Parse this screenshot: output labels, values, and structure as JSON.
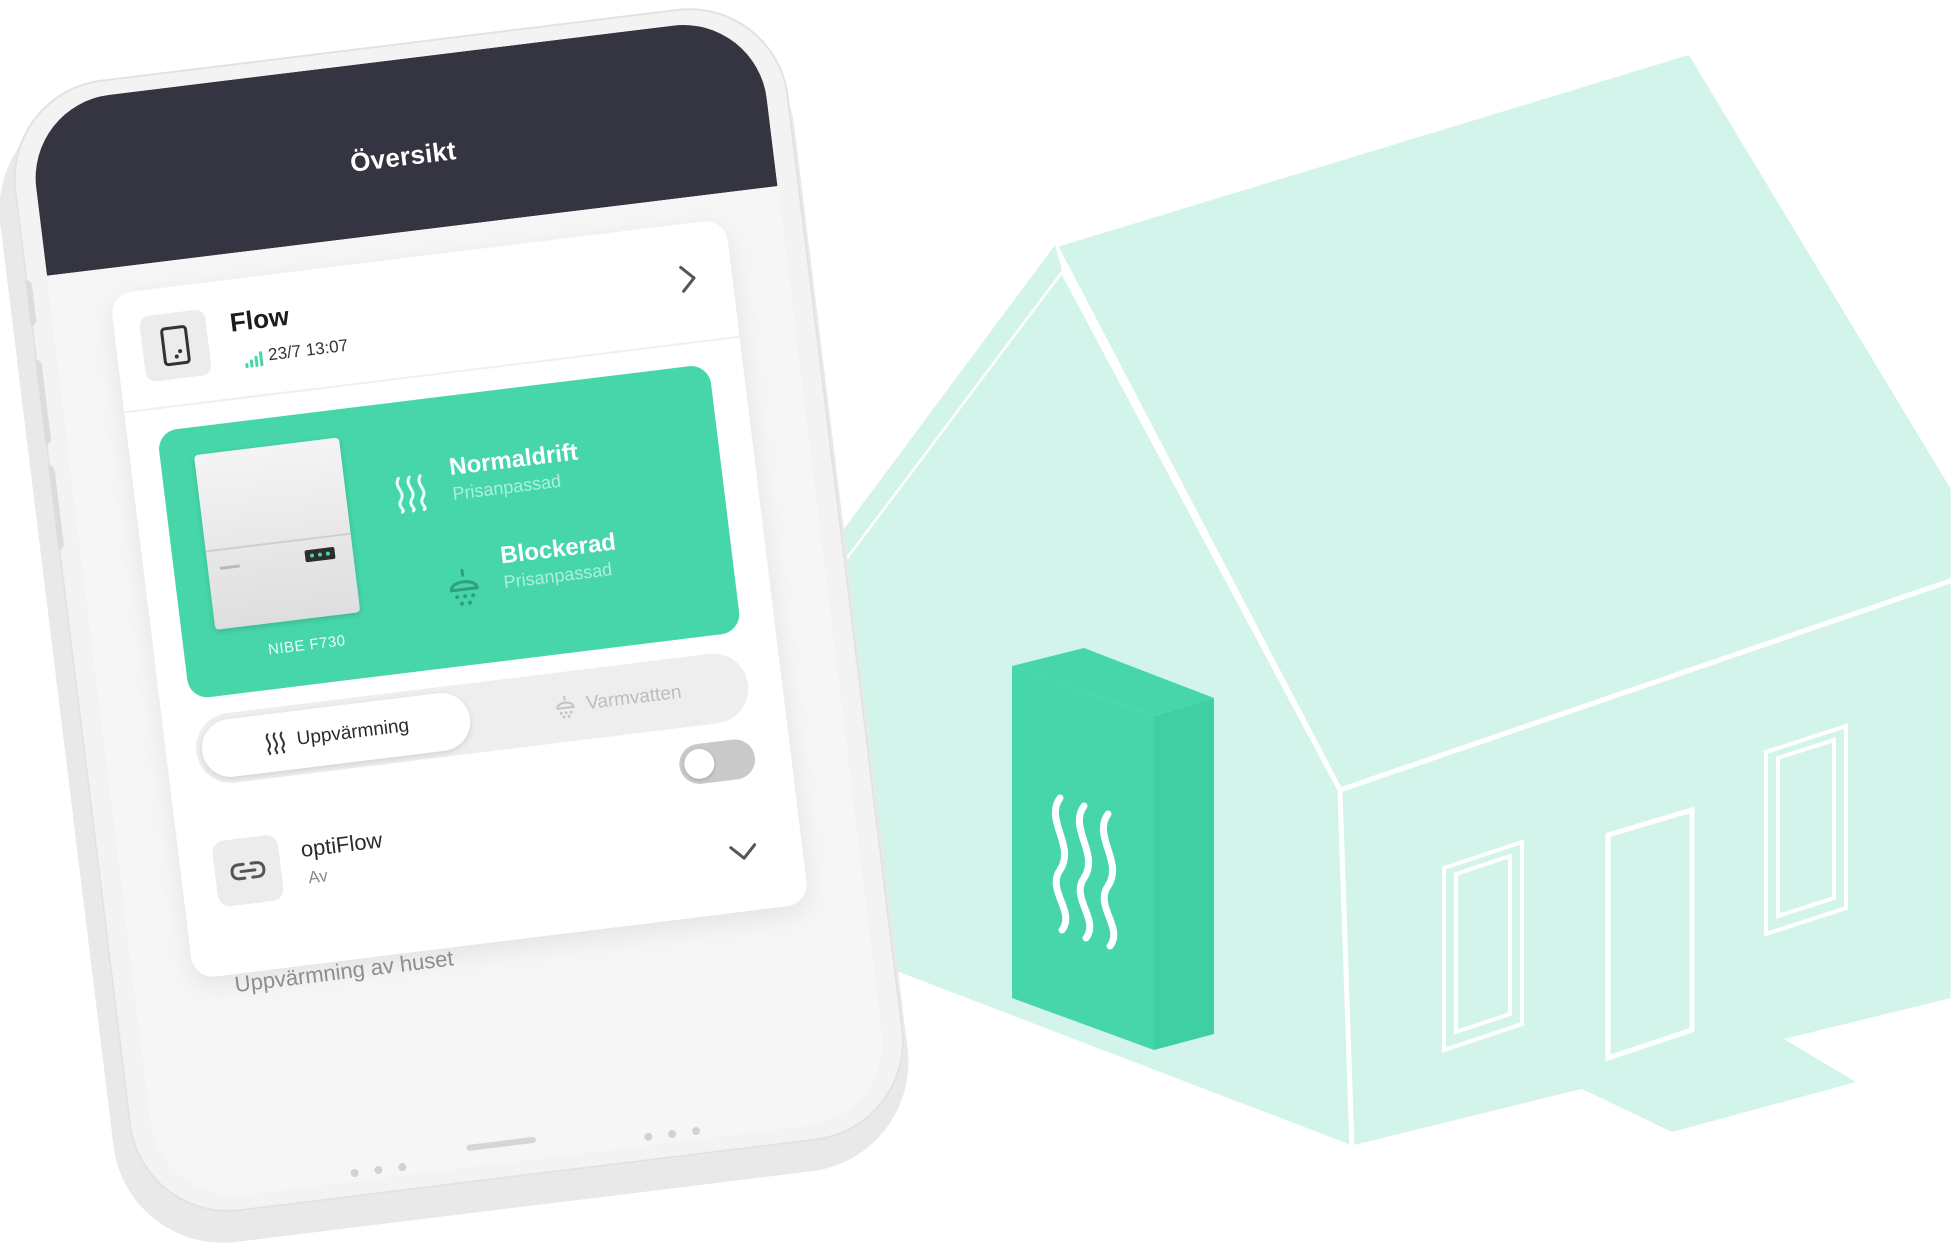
{
  "colors": {
    "accent": "#46d6aa",
    "header_bg": "#343540",
    "house_fill": "#d2f4ea",
    "house_stroke": "#ffffff"
  },
  "header": {
    "title": "Översikt"
  },
  "device": {
    "name": "Flow",
    "timestamp": "23/7 13:07",
    "icon": "phone-device-icon",
    "signal_icon": "signal-bars-icon"
  },
  "status": {
    "pump_model": "NIBE F730",
    "heating": {
      "title": "Normaldrift",
      "subtitle": "Prisanpassad",
      "icon": "heat-waves-icon"
    },
    "hot_water": {
      "title": "Blockerad",
      "subtitle": "Prisanpassad",
      "icon": "shower-icon"
    }
  },
  "tabs": [
    {
      "label": "Uppvärmning",
      "icon": "heat-waves-icon",
      "active": true
    },
    {
      "label": "Varmvatten",
      "icon": "shower-icon",
      "active": false
    }
  ],
  "optiflow": {
    "title": "optiFlow",
    "status": "Av",
    "icon": "link-icon",
    "enabled": false
  },
  "section": {
    "label": "Uppvärmning av huset"
  }
}
